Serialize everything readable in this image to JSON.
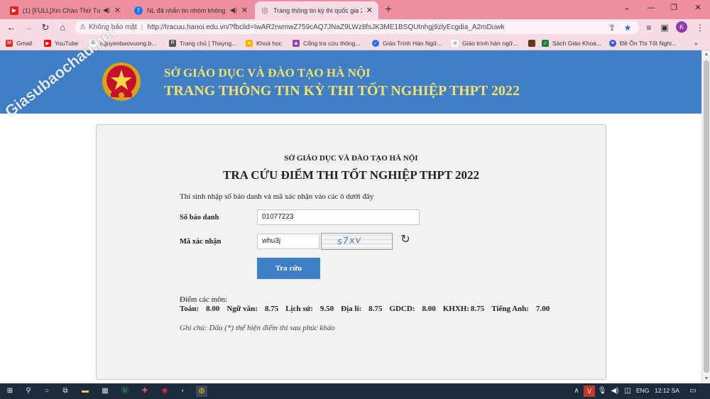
{
  "browser": {
    "tabs": [
      {
        "title": "(1) [FULL]Xin Chào Thứ Tư",
        "favicon_color": "#e62117",
        "active": false
      },
      {
        "title": "NL đã nhắn tin nhóm không",
        "favicon_color": "#1877f2",
        "active": false
      },
      {
        "title": "Trang thông tin kỳ thi quốc gia 2",
        "favicon_color": "#666666",
        "active": true
      }
    ],
    "new_tab": "+",
    "address": {
      "security_label": "Không bảo mật",
      "url": "http://tracuu.hanoi.edu.vn/?fbclid=IwAR2rwmwZ759cAQ7JNaZ9LWz8fsJK3ME1BSQUtnhgj9zlyEcgdia_A2mDuwk"
    },
    "profile_initial": "K",
    "bookmarks": [
      {
        "label": "Gmail",
        "color": "#d93025"
      },
      {
        "label": "YouTube",
        "color": "#ff0000"
      },
      {
        "label": "nguyenbaovuong.b...",
        "color": "#4285f4"
      },
      {
        "label": "Trang chủ | Thayng...",
        "color": "#555555"
      },
      {
        "label": "Khoá học",
        "color": "#f4b400"
      },
      {
        "label": "Cổng tra cứu thông...",
        "color": "#8e44ad"
      },
      {
        "label": "Giáo Trình Hán Ngữ...",
        "color": "#1a73e8"
      },
      {
        "label": "Giáo trình hán ngữ...",
        "color": "#777777"
      },
      {
        "label": "",
        "color": "#5a3b1a"
      },
      {
        "label": "Sách Giáo Khoa...",
        "color": "#188038"
      },
      {
        "label": "Đề Ôn Thi Tốt Nghi...",
        "color": "#3b5bdb"
      }
    ]
  },
  "watermark": "Giasubaochau.net",
  "header": {
    "line1": "SỞ GIÁO DỤC VÀ ĐÀO TẠO HÀ NỘI",
    "line2": "TRANG THÔNG TIN KỲ THI TỐT NGHIỆP THPT 2022"
  },
  "form": {
    "department": "SỞ GIÁO DỤC VÀ ĐÀO TẠO HÀ NỘI",
    "title": "TRA CỨU ĐIỂM THI TỐT NGHIỆP THPT 2022",
    "instruction": "Thí sinh nhập số báo danh và mã xác nhận vào các ô dưới đây",
    "sbd_label": "Số báo danh",
    "sbd_value": "01077223",
    "captcha_label": "Mã xác nhận",
    "captcha_value": "whu3j",
    "captcha_image_text": "s7xv",
    "submit_label": "Tra cứu"
  },
  "results": {
    "heading": "Điểm các môn:",
    "scores": [
      {
        "subject": "Toán:",
        "value": "8.00"
      },
      {
        "subject": "Ngữ văn:",
        "value": "8.75"
      },
      {
        "subject": "Lịch sử:",
        "value": "9.50"
      },
      {
        "subject": "Địa lí:",
        "value": "8.75"
      },
      {
        "subject": "GDCD:",
        "value": "8.00"
      },
      {
        "subject": "KHXH:",
        "value": "8.75"
      },
      {
        "subject": "Tiếng Anh:",
        "value": "7.00"
      }
    ],
    "note": "Ghi chú: Dấu (*) thể hiện điểm thi sau phúc khảo"
  },
  "taskbar": {
    "language": "ENG",
    "time": "12:12 SA"
  }
}
